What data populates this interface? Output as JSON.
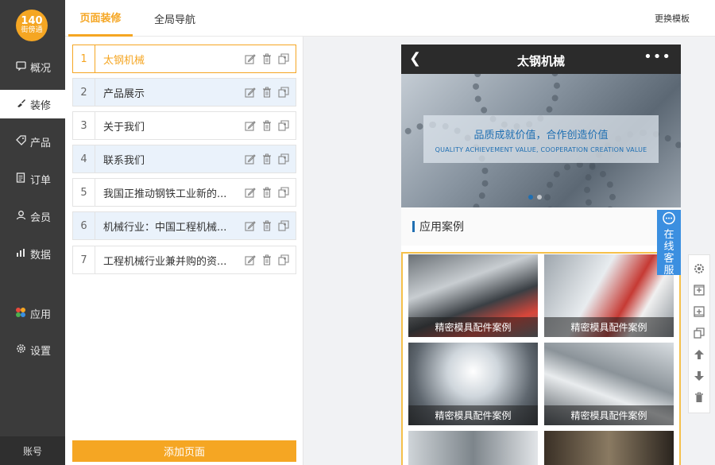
{
  "sidebar": {
    "logo": {
      "top": "140",
      "bottom": "街傍通"
    },
    "items": [
      {
        "label": "概况",
        "icon": "message-icon"
      },
      {
        "label": "装修",
        "icon": "brush-icon"
      },
      {
        "label": "产品",
        "icon": "tag-icon"
      },
      {
        "label": "订单",
        "icon": "document-icon"
      },
      {
        "label": "会员",
        "icon": "user-icon"
      },
      {
        "label": "数据",
        "icon": "bar-chart-icon"
      },
      {
        "label": "应用",
        "icon": "apps-icon"
      },
      {
        "label": "设置",
        "icon": "gear-icon"
      }
    ],
    "account": "账号"
  },
  "tabs": [
    {
      "label": "页面装修"
    },
    {
      "label": "全局导航"
    }
  ],
  "change_template": "更换模板",
  "pages": [
    {
      "num": "1",
      "name": "太钢机械"
    },
    {
      "num": "2",
      "name": "产品展示"
    },
    {
      "num": "3",
      "name": "关于我们"
    },
    {
      "num": "4",
      "name": "联系我们"
    },
    {
      "num": "5",
      "name": "我国正推动钢铁工业新的..."
    },
    {
      "num": "6",
      "name": "机械行业：中国工程机械..."
    },
    {
      "num": "7",
      "name": "工程机械行业兼并购的资..."
    }
  ],
  "add_page": "添加页面",
  "phone": {
    "title": "太钢机械",
    "banner_cn": "品质成就价值，合作创造价值",
    "banner_en": "QUALITY ACHIEVEMENT VALUE, COOPERATION CREATION VALUE",
    "section_title": "应用案例",
    "cases": [
      {
        "caption": "精密模具配件案例"
      },
      {
        "caption": "精密模具配件案例"
      },
      {
        "caption": "精密模具配件案例"
      },
      {
        "caption": "精密模具配件案例"
      }
    ],
    "online_service": [
      "在",
      "线",
      "客",
      "服"
    ]
  },
  "colors": {
    "accent": "#f5a623",
    "blue": "#1f6fb2",
    "service": "#3b8fe0"
  }
}
